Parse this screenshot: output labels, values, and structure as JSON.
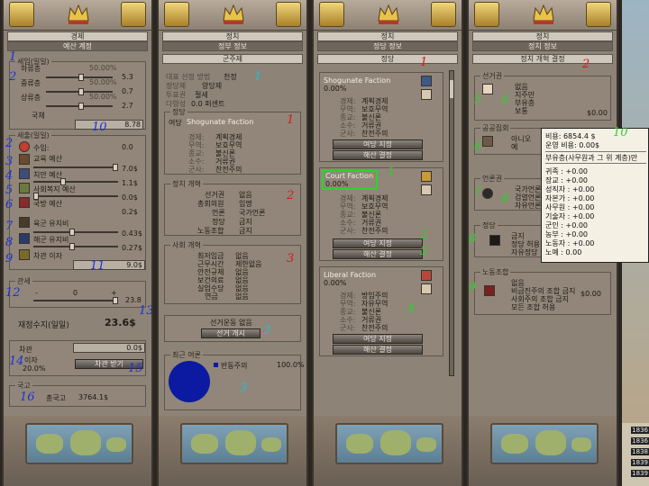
{
  "panel1": {
    "title": "경제",
    "subtitle": "예산 계정",
    "income_label": "세입(일일)",
    "strata": [
      {
        "label": "하류층",
        "pct": "50.00%",
        "value": "5.3"
      },
      {
        "label": "중류층",
        "pct": "50.00%",
        "value": "0.7"
      },
      {
        "label": "상류층",
        "pct": "50.00%",
        "value": "2.7"
      }
    ],
    "tariff_label": "국채",
    "tariff_value": "8.78",
    "expense_label": "세출(일일)",
    "expenses": [
      {
        "label": "수입:",
        "value": "0.0"
      },
      {
        "label": "교육 예산",
        "value": "7.0$"
      },
      {
        "label": "치안 예산",
        "value": "1.1$"
      },
      {
        "label": "사회복지 예산",
        "value": "0.0$"
      },
      {
        "label": "국방 예산",
        "value": "0.2$"
      },
      {
        "label": "육군 유지비",
        "value": "0.43$"
      },
      {
        "label": "해군 유지비",
        "value": "0.27$"
      },
      {
        "label": "차관 이자",
        "value": "9.0$"
      }
    ],
    "tariff2_label": "관세",
    "tariff2_minus": "-",
    "tariff2_zero": "0",
    "tariff2_plus": "+",
    "tariff2_value": "23.8",
    "balance_label": "재정수지(일일)",
    "balance_value": "23.6$",
    "loan_label": "차관",
    "loan_value": "0.0$",
    "interest_label": "이자",
    "interest_value": "20.0%",
    "take_loan_button": "차관 받기",
    "treasury_label": "국고",
    "treasury_text": "총국고",
    "treasury_value": "3764.1$"
  },
  "panel2": {
    "title": "정치",
    "subtitle": "정부 정보",
    "govt_type": "군주제",
    "election_label": "대표 선정 방법",
    "election_value": "천정",
    "ruling_party_label": "정당제",
    "ruling_party_value": "양당제",
    "voting_label": "투표권",
    "voting_value": "절세",
    "plurality_label": "다양성",
    "plurality_value": "0.0 퍼센트",
    "party_box_label": "정당",
    "ruling_party_prefix": "여당",
    "ruling_party_name": "Shogunate Faction",
    "policies": [
      {
        "label": "경제:",
        "value": "계획경제"
      },
      {
        "label": "무역:",
        "value": "보호무역"
      },
      {
        "label": "종교:",
        "value": "불신론"
      },
      {
        "label": "소수:",
        "value": "거류권"
      },
      {
        "label": "군사:",
        "value": "찬전주의"
      }
    ],
    "political_reforms_label": "정치 개혁",
    "political_reforms": [
      {
        "label": "선거권",
        "value": "없음"
      },
      {
        "label": "총회의원",
        "value": "임명"
      },
      {
        "label": "언론",
        "value": "국가언론"
      },
      {
        "label": "정당",
        "value": "금지"
      },
      {
        "label": "노동조합",
        "value": "금지"
      }
    ],
    "social_reforms_label": "사회 개혁",
    "social_reforms": [
      {
        "label": "최저임금",
        "value": "없음"
      },
      {
        "label": "근무시간",
        "value": "제한없음"
      },
      {
        "label": "안전규제",
        "value": "없음"
      },
      {
        "label": "보건의료",
        "value": "없음"
      },
      {
        "label": "실업수당",
        "value": "없음"
      },
      {
        "label": "연금",
        "value": "없음"
      }
    ],
    "election_status": "선거운동 없음",
    "election_button": "선거 개시",
    "opinion_label": "최근 여론",
    "opinion_party": "반동주의",
    "opinion_pct": "100.0%",
    "opinion_color": "#0b1aa0"
  },
  "panel3": {
    "title": "정치",
    "subtitle": "정당 정보",
    "tab": "정당",
    "factions": [
      {
        "name": "Shogunate Faction",
        "pct": "0.00%",
        "policies": [
          "계획경제",
          "보호무역",
          "불신론",
          "거류권",
          "찬전주의"
        ],
        "btn1": "여당 지정",
        "btn2": "해산 결정"
      },
      {
        "name": "Court Faction",
        "pct": "0.00%",
        "policies": [
          "계획경제",
          "보호무역",
          "불신론",
          "거류권",
          "찬전주의"
        ],
        "btn1": "여당 지정",
        "btn2": "해산 결정"
      },
      {
        "name": "Liberal Faction",
        "pct": "0.00%",
        "policies": [
          "방임주의",
          "자유무역",
          "불신론",
          "거류권",
          "찬전주의"
        ],
        "btn1": "여당 지정",
        "btn2": "해산 결정"
      }
    ],
    "policy_labels": [
      "경제:",
      "무역:",
      "종교:",
      "소수:",
      "군사:"
    ]
  },
  "panel4": {
    "title": "정치",
    "subtitle": "정치 정보",
    "tab": "정치 개혁 결정",
    "suffrage_label": "선거권",
    "suffrage_options": [
      "없음",
      "지주만",
      "부유층",
      "보통"
    ],
    "suffrage_cost": "$0.00",
    "voting_label": "공공집회",
    "voting_options": [
      "아니오",
      "예"
    ],
    "press_label": "언론권",
    "press_options": [
      "국가언론",
      "검열언론",
      "자유언론"
    ],
    "parties_label": "정당",
    "parties_options": [
      "금지",
      "정당 허용",
      "자유정당"
    ],
    "unions_label": "노동조합",
    "unions_options": [
      "없음",
      "비급진주의 조합 금지",
      "사회주의 조합 금지",
      "모든 조합 허용"
    ],
    "unions_cost": "$0.00"
  },
  "tooltip": {
    "cost": "비용: 6854.4 $",
    "upkeep": "운영 비용: 0.00$",
    "note": "부유층(사무원과 그 위 계층)만",
    "lines": [
      "귀족 : +0.00",
      "장교 : +0.00",
      "성직자 : +0.00",
      "자본가 : +0.00",
      "사무원 : +0.00",
      "기술자 : +0.00",
      "군인 : +0.00",
      "농부 : +0.00",
      "노동자 : +0.00",
      "노예 : 0.00"
    ]
  },
  "right_strip": {
    "labels": [
      "1836",
      "1836",
      "1838",
      "1839",
      "1839"
    ]
  },
  "annotations": {
    "p1": [
      "1",
      "2",
      "3",
      "4",
      "5",
      "6",
      "7",
      "8",
      "9",
      "10",
      "11",
      "12",
      "13",
      "14",
      "15",
      "16"
    ],
    "p2": [
      "1",
      "2",
      "3",
      "1",
      "2",
      "3"
    ],
    "p3": [
      "1",
      "1",
      "2",
      "3",
      "4"
    ],
    "p4": [
      "1",
      "2",
      "3",
      "4",
      "5",
      "6",
      "7",
      "8",
      "9",
      "10"
    ]
  }
}
